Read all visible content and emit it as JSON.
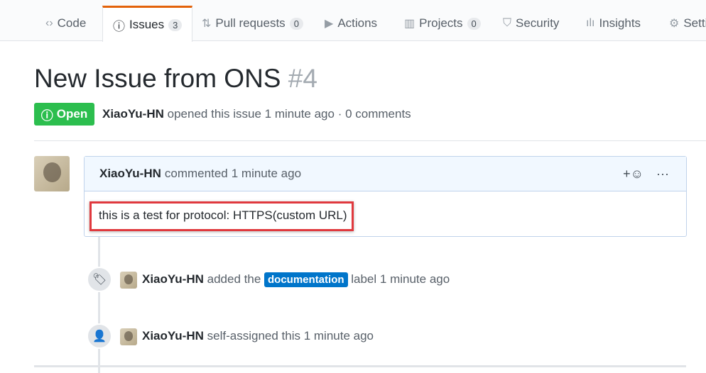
{
  "tabs": [
    {
      "label": "Code",
      "icon": "code-icon"
    },
    {
      "label": "Issues",
      "count": "3",
      "icon": "issue-opened-icon",
      "selected": true
    },
    {
      "label": "Pull requests",
      "count": "0",
      "icon": "git-pull-request-icon"
    },
    {
      "label": "Actions",
      "icon": "play-icon"
    },
    {
      "label": "Projects",
      "count": "0",
      "icon": "project-icon"
    },
    {
      "label": "Security",
      "icon": "shield-icon"
    },
    {
      "label": "Insights",
      "icon": "graph-icon"
    },
    {
      "label": "Settings",
      "icon": "gear-icon"
    }
  ],
  "issue": {
    "title": "New Issue from ONS",
    "number": "#4",
    "state": "Open",
    "author": "XiaoYu-HN",
    "meta": "opened this issue 1 minute ago · 0 comments"
  },
  "comment": {
    "author": "XiaoYu-HN",
    "action": "commented",
    "time": "1 minute ago",
    "add_reaction": "+☺",
    "more": "···",
    "body": "this is a test for protocol: HTTPS(custom URL)"
  },
  "events": [
    {
      "icon": "tag-icon",
      "actor": "XiaoYu-HN",
      "pre": "added the",
      "label": "documentation",
      "label_color": "#0075ca",
      "post": "label 1 minute ago"
    },
    {
      "icon": "person-icon",
      "actor": "XiaoYu-HN",
      "pre": "self-assigned this 1 minute ago"
    }
  ],
  "colors": {
    "open": "#2cbe4e",
    "accent": "#e36209",
    "highlight": "#e0393e"
  }
}
